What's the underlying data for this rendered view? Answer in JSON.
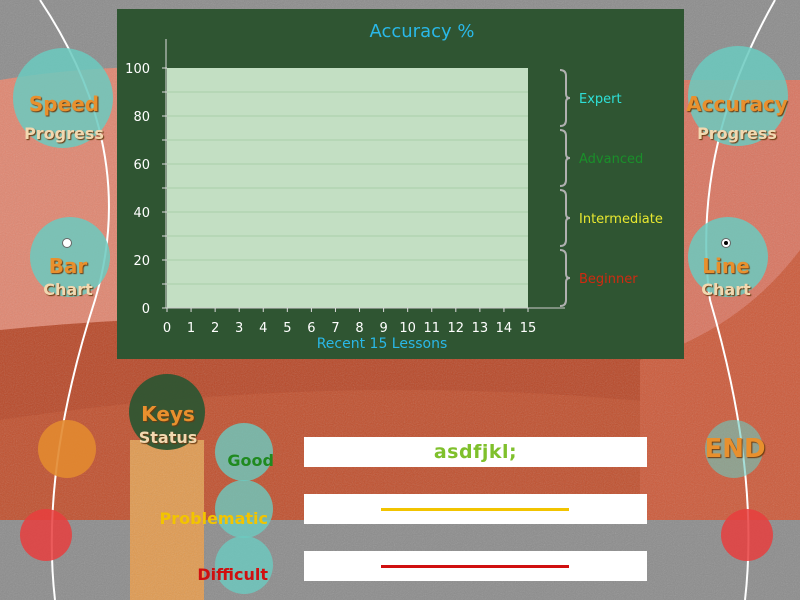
{
  "chart": {
    "title": "Accuracy %",
    "xlabel": "Recent 15 Lessons",
    "levels": [
      {
        "label": "Expert",
        "color": "#2ee0d8"
      },
      {
        "label": "Advanced",
        "color": "#1a8f2a"
      },
      {
        "label": "Intermediate",
        "color": "#e8e830"
      },
      {
        "label": "Beginner",
        "color": "#d02a10"
      }
    ]
  },
  "chart_data": {
    "type": "bar",
    "title": "Accuracy %",
    "xlabel": "Recent 15 Lessons",
    "ylabel": "",
    "x_ticks": [
      "0",
      "1",
      "2",
      "3",
      "4",
      "5",
      "6",
      "7",
      "8",
      "9",
      "10",
      "11",
      "12",
      "13",
      "14",
      "15"
    ],
    "y_ticks": [
      "0",
      "20",
      "40",
      "60",
      "80",
      "100"
    ],
    "xlim": [
      0,
      15
    ],
    "ylim": [
      0,
      100
    ],
    "values": [],
    "grid": true
  },
  "nav": {
    "speed": {
      "line1": "Speed",
      "line2": "Progress"
    },
    "accuracy": {
      "line1": "Accuracy",
      "line2": "Progress"
    },
    "bar": {
      "line1": "Bar",
      "line2": "Chart",
      "selected": false
    },
    "line": {
      "line1": "Line",
      "line2": "Chart",
      "selected": true
    },
    "keys": {
      "line1": "Keys",
      "line2": "Status"
    },
    "end": "END"
  },
  "status": {
    "good": {
      "label": "Good",
      "color": "#1f8a1f",
      "keys": "asdfjkl;"
    },
    "problematic": {
      "label": "Problematic",
      "color": "#f2c400",
      "keys": ""
    },
    "difficult": {
      "label": "Difficult",
      "color": "#d01010",
      "keys": ""
    }
  },
  "colors": {
    "panel": "#2f5532",
    "plot_area": "#c3dfc3",
    "title": "#2ab8e8",
    "bracket": "#b0b0b0"
  }
}
